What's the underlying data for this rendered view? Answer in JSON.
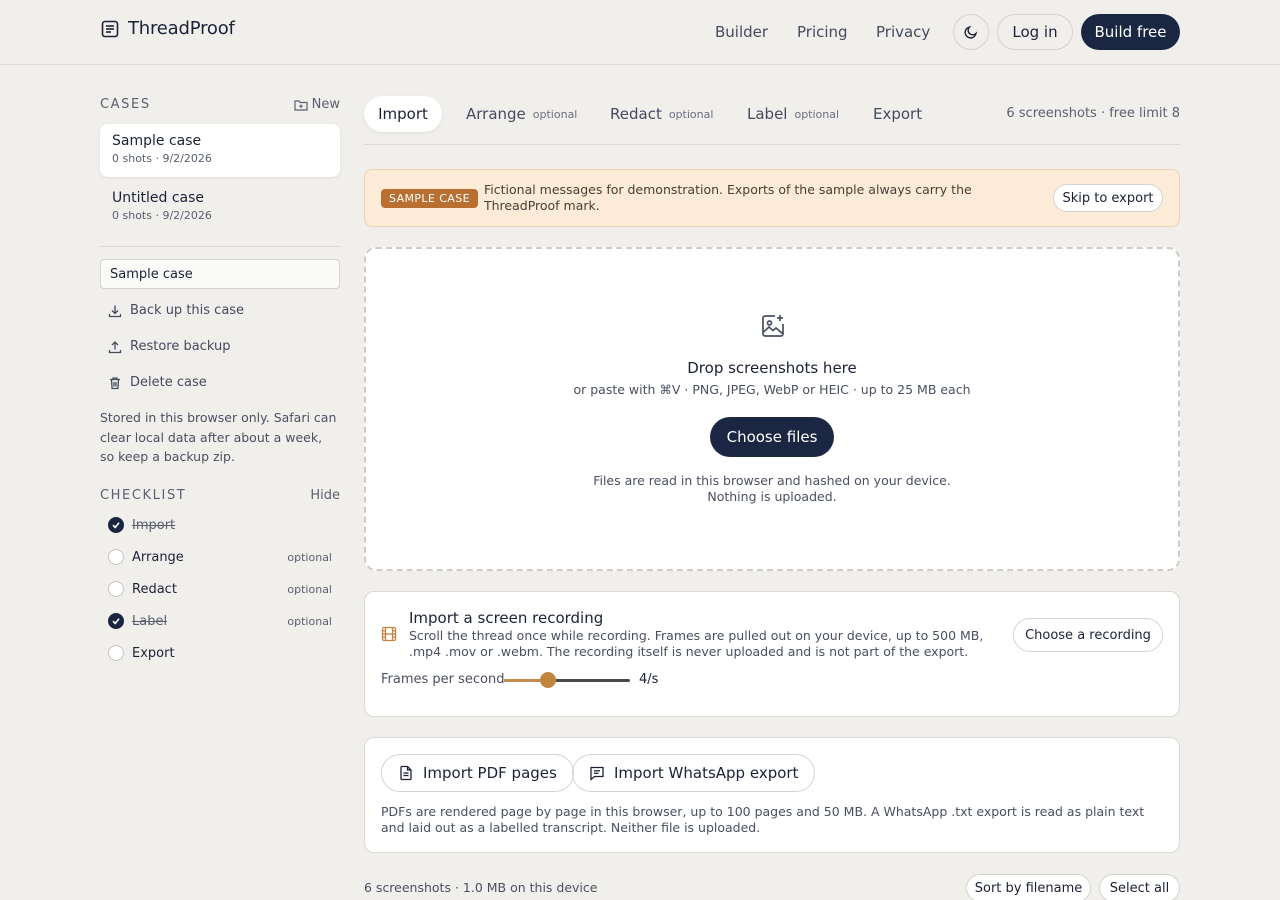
{
  "header": {
    "brand": "ThreadProof",
    "brand_icon": "document-list-icon",
    "nav": [
      "Builder",
      "Pricing",
      "Privacy"
    ],
    "theme_icon": "moon-icon",
    "login_label": "Log in",
    "cta_label": "Build free"
  },
  "sidebar": {
    "cases_heading": "CASES",
    "new_label": "New",
    "cases": [
      {
        "name": "Sample case",
        "meta": "0 shots · 9/2/2026",
        "active": true
      },
      {
        "name": "Untitled case",
        "meta": "0 shots · 9/2/2026",
        "active": false
      }
    ],
    "case_name_value": "Sample case",
    "actions": [
      {
        "label": "Back up this case",
        "icon": "download-icon"
      },
      {
        "label": "Restore backup",
        "icon": "upload-icon"
      },
      {
        "label": "Delete case",
        "icon": "trash-icon"
      }
    ],
    "storage_note": "Stored in this browser only. Safari can clear local data after about a week, so keep a backup zip.",
    "checklist_heading": "CHECKLIST",
    "checklist_hide": "Hide",
    "checklist": [
      {
        "label": "Import",
        "done": true,
        "optional": ""
      },
      {
        "label": "Arrange",
        "done": false,
        "optional": "optional"
      },
      {
        "label": "Redact",
        "done": false,
        "optional": "optional"
      },
      {
        "label": "Label",
        "done": true,
        "optional": "optional"
      },
      {
        "label": "Export",
        "done": false,
        "optional": ""
      }
    ]
  },
  "tabs": {
    "items": [
      {
        "label": "Import",
        "optional": ""
      },
      {
        "label": "Arrange",
        "optional": "optional"
      },
      {
        "label": "Redact",
        "optional": "optional"
      },
      {
        "label": "Label",
        "optional": "optional"
      },
      {
        "label": "Export",
        "optional": ""
      }
    ],
    "active": "Import",
    "count_text": "6 screenshots · free limit 8"
  },
  "banner": {
    "badge": "SAMPLE CASE",
    "text": "Fictional messages for demonstration. Exports of the sample always carry the ThreadProof mark.",
    "button": "Skip to export",
    "accent": "#b86f31"
  },
  "dropzone": {
    "icon": "image-plus-icon",
    "title": "Drop screenshots here",
    "subtitle": "or paste with ⌘V · PNG, JPEG, WebP or HEIC · up to 25 MB each",
    "button": "Choose files",
    "note_line1": "Files are read in this browser and hashed on your device.",
    "note_line2": "Nothing is uploaded."
  },
  "recording": {
    "icon": "film-icon",
    "title": "Import a screen recording",
    "description": "Scroll the thread once while recording. Frames are pulled out on your device, up to 500 MB, .mp4 .mov or .webm. The recording itself is never uploaded and is not part of the export.",
    "button": "Choose a recording",
    "fps_label": "Frames per second",
    "fps_value": "4/s",
    "fps_level": 0.35
  },
  "other_imports": {
    "pdf_label": "Import PDF pages",
    "pdf_icon": "file-text-icon",
    "whatsapp_label": "Import WhatsApp export",
    "whatsapp_icon": "message-square-icon",
    "note": "PDFs are rendered page by page in this browser, up to 100 pages and 50 MB. A WhatsApp .txt export is read as plain text and laid out as a labelled transcript. Neither file is uploaded."
  },
  "footer": {
    "count": "6 screenshots · 1.0 MB on this device",
    "sort_label": "Sort by filename",
    "select_label": "Select all"
  },
  "colors": {
    "navy": "#1b2742",
    "background": "#f1efec",
    "banner_bg": "#fbebd7",
    "slider_accent": "#c3843f"
  }
}
